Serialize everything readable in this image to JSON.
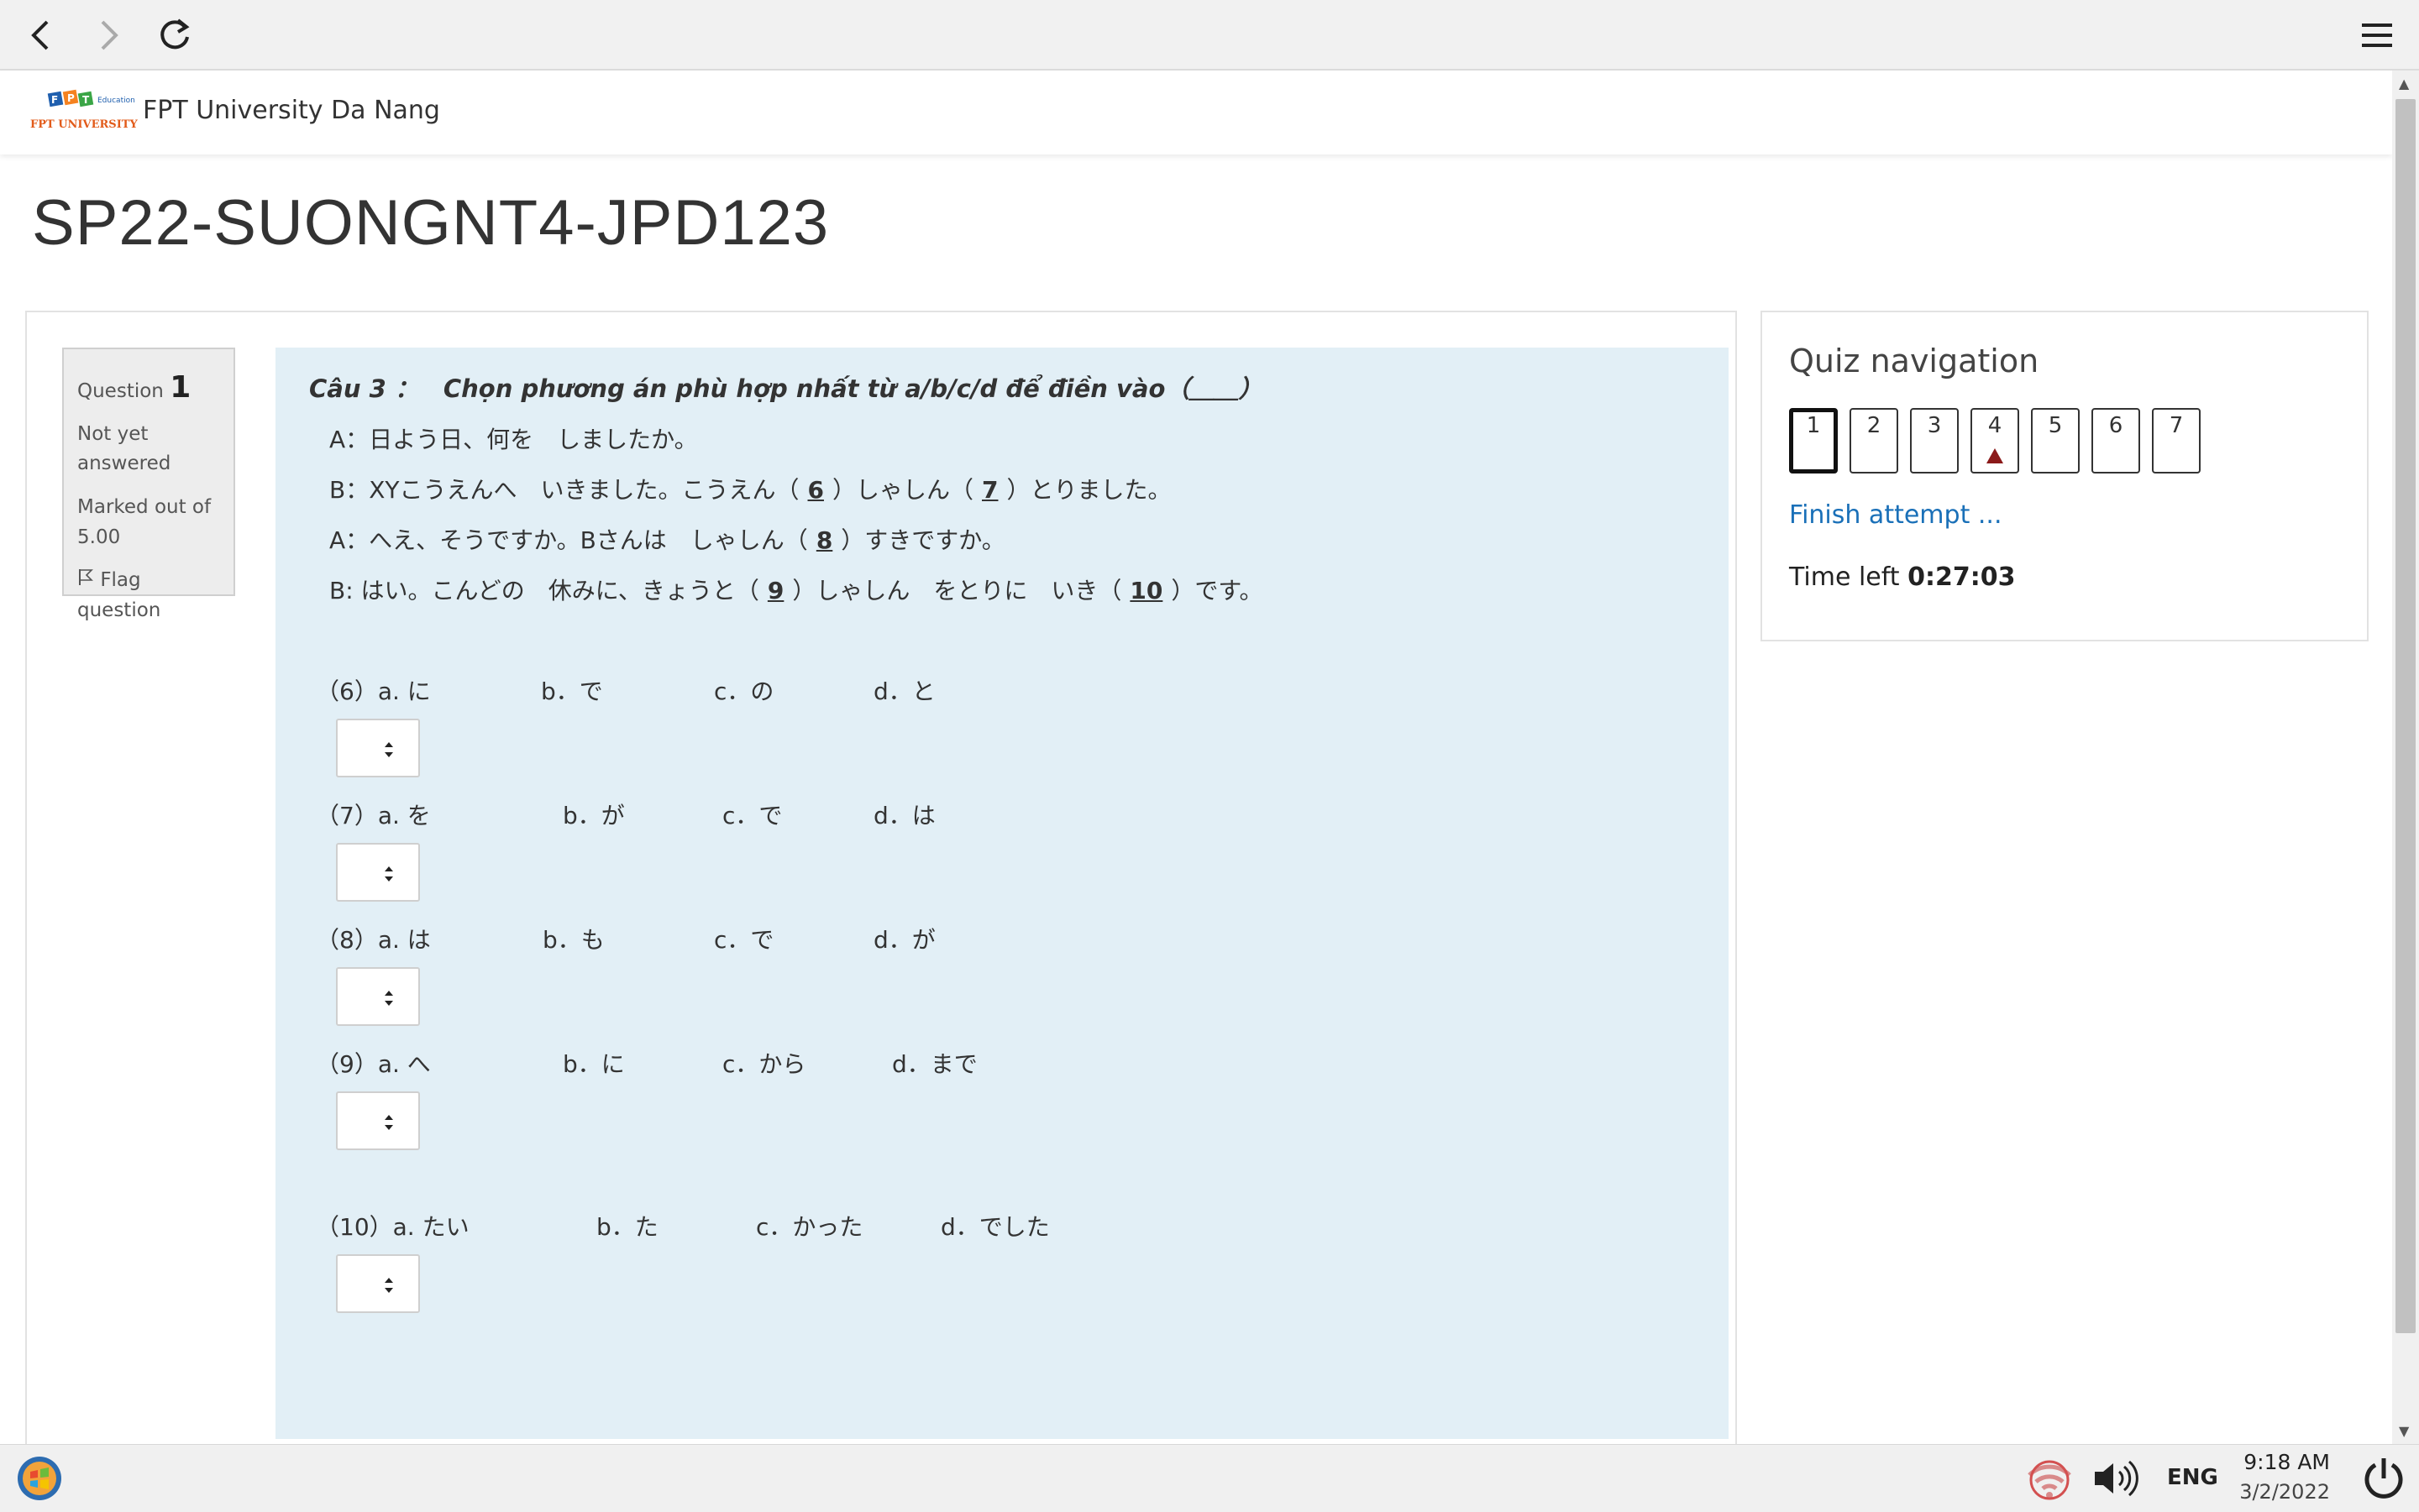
{
  "browser": {
    "back_icon": "back-arrow-icon",
    "forward_icon": "forward-arrow-icon",
    "reload_icon": "reload-icon",
    "menu_icon": "hamburger-menu-icon"
  },
  "site": {
    "logo_top": "FPT",
    "logo_edu": "Education",
    "logo_bottom": "FPT UNIVERSITY",
    "name": "FPT University Da Nang"
  },
  "page": {
    "title": "SP22-SUONGNT4-JPD123"
  },
  "question_info": {
    "label": "Question",
    "number": "1",
    "state": "Not yet answered",
    "marked_out_of": "Marked out of 5.00",
    "flag_label": "Flag question"
  },
  "question": {
    "heading": "Câu 3 ：　Chọn phương án phù hợp nhất từ a/b/c/d để điền vào（＿＿）",
    "lines": [
      {
        "parts": [
          "A：日よう日、何を　しましたか。"
        ]
      },
      {
        "parts": [
          "B：XYこうえんへ　いきました。こうえん（",
          "6",
          "）しゃしん（",
          "7",
          "）とりました。"
        ]
      },
      {
        "parts": [
          "A：へえ、そうですか。Bさんは　しゃしん（",
          "8",
          "）すきですか。"
        ]
      },
      {
        "parts": [
          "B: はい。こんどの　休みに、きょうと（",
          "9",
          "）しゃしん　をとりに　いき（",
          "10",
          "）です。"
        ]
      }
    ],
    "options": [
      {
        "no": "（6）a. に",
        "b": "b．で",
        "c": "c．の",
        "d": "d．と"
      },
      {
        "no": "（7）a. を",
        "b": "b．が",
        "c": "c．で",
        "d": "d．は"
      },
      {
        "no": "（8）a. は",
        "b": "b．も",
        "c": "c．で",
        "d": "d．が"
      },
      {
        "no": "（9）a. へ",
        "b": "b．に",
        "c": "c．から",
        "d": "d．まで"
      },
      {
        "no": "（10）a. たい",
        "b": "b．た",
        "c": "c．かった",
        "d": "d．でした"
      }
    ]
  },
  "quiz_nav": {
    "title": "Quiz navigation",
    "buttons": [
      "1",
      "2",
      "3",
      "4",
      "5",
      "6",
      "7"
    ],
    "current": "1",
    "flagged": "4",
    "finish_label": "Finish attempt ...",
    "time_label": "Time left",
    "time_value": "0:27:03"
  },
  "taskbar": {
    "lang": "ENG",
    "time": "9:18 AM",
    "date": "3/2/2022"
  },
  "colors": {
    "question_bg": "#e2eff6",
    "link": "#1a70b8",
    "flag": "#8b1a1a",
    "info_bg": "#ededed"
  }
}
